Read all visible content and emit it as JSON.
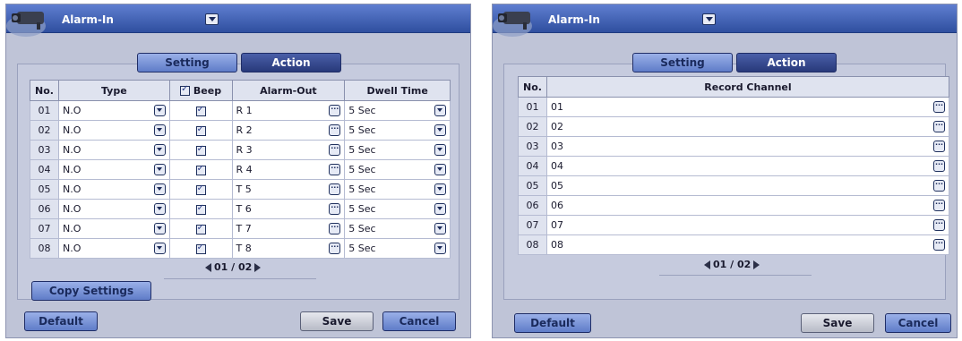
{
  "left": {
    "title": "Alarm-In",
    "tabs": {
      "setting": "Setting",
      "action": "Action"
    },
    "headers": {
      "no": "No.",
      "type": "Type",
      "beep": "Beep",
      "alarm_out": "Alarm-Out",
      "dwell": "Dwell Time"
    },
    "rows": [
      {
        "no": "01",
        "type": "N.O",
        "alarm_out": "R 1",
        "dwell": "5 Sec"
      },
      {
        "no": "02",
        "type": "N.O",
        "alarm_out": "R 2",
        "dwell": "5 Sec"
      },
      {
        "no": "03",
        "type": "N.O",
        "alarm_out": "R 3",
        "dwell": "5 Sec"
      },
      {
        "no": "04",
        "type": "N.O",
        "alarm_out": "R 4",
        "dwell": "5 Sec"
      },
      {
        "no": "05",
        "type": "N.O",
        "alarm_out": "T 5",
        "dwell": "5 Sec"
      },
      {
        "no": "06",
        "type": "N.O",
        "alarm_out": "T 6",
        "dwell": "5 Sec"
      },
      {
        "no": "07",
        "type": "N.O",
        "alarm_out": "T 7",
        "dwell": "5 Sec"
      },
      {
        "no": "08",
        "type": "N.O",
        "alarm_out": "T 8",
        "dwell": "5 Sec"
      }
    ],
    "pager": "01 / 02",
    "copy_settings": "Copy Settings",
    "buttons": {
      "default": "Default",
      "save": "Save",
      "cancel": "Cancel"
    }
  },
  "right": {
    "title": "Alarm-In",
    "tabs": {
      "setting": "Setting",
      "action": "Action"
    },
    "headers": {
      "no": "No.",
      "record_channel": "Record Channel"
    },
    "rows": [
      {
        "no": "01",
        "channel": "01"
      },
      {
        "no": "02",
        "channel": "02"
      },
      {
        "no": "03",
        "channel": "03"
      },
      {
        "no": "04",
        "channel": "04"
      },
      {
        "no": "05",
        "channel": "05"
      },
      {
        "no": "06",
        "channel": "06"
      },
      {
        "no": "07",
        "channel": "07"
      },
      {
        "no": "08",
        "channel": "08"
      }
    ],
    "pager": "01 / 02",
    "buttons": {
      "default": "Default",
      "save": "Save",
      "cancel": "Cancel"
    }
  },
  "icons": {
    "camera": "camera-icon",
    "dropdown": "dropdown-arrow-icon",
    "more": "ellipsis-icon",
    "check": "checkbox-checked-icon"
  }
}
